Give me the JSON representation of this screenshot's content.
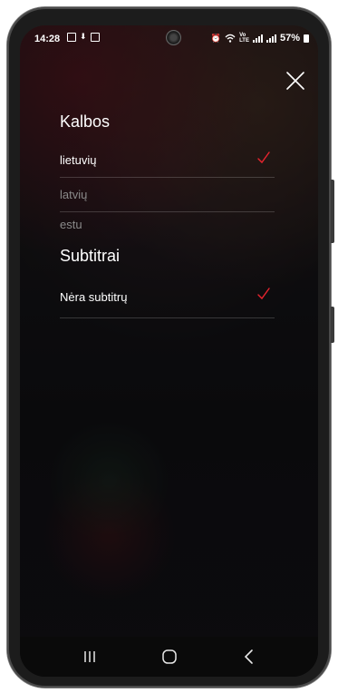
{
  "status_bar": {
    "time": "14:28",
    "battery_percent": "57%",
    "icons_left": [
      "gallery-icon",
      "download-icon",
      "sd-card-icon"
    ],
    "icons_right": [
      "alarm-icon",
      "wifi-icon",
      "volte-icon",
      "signal-icon",
      "signal-icon",
      "battery-icon"
    ]
  },
  "audio_section": {
    "title": "Kalbos",
    "options": [
      {
        "label": "lietuvių",
        "selected": true
      },
      {
        "label": "latvių",
        "selected": false
      },
      {
        "label": "estu",
        "selected": false
      }
    ]
  },
  "subtitles_section": {
    "title": "Subtitrai",
    "options": [
      {
        "label": "Nėra subtitrų",
        "selected": true
      }
    ]
  },
  "colors": {
    "accent": "#e8242e",
    "text": "#ffffff",
    "text_dim": "#8a8a8a"
  },
  "icons": {
    "close": "close-icon",
    "check": "checkmark-icon",
    "nav_recents": "recents-icon",
    "nav_home": "home-icon",
    "nav_back": "back-icon"
  }
}
